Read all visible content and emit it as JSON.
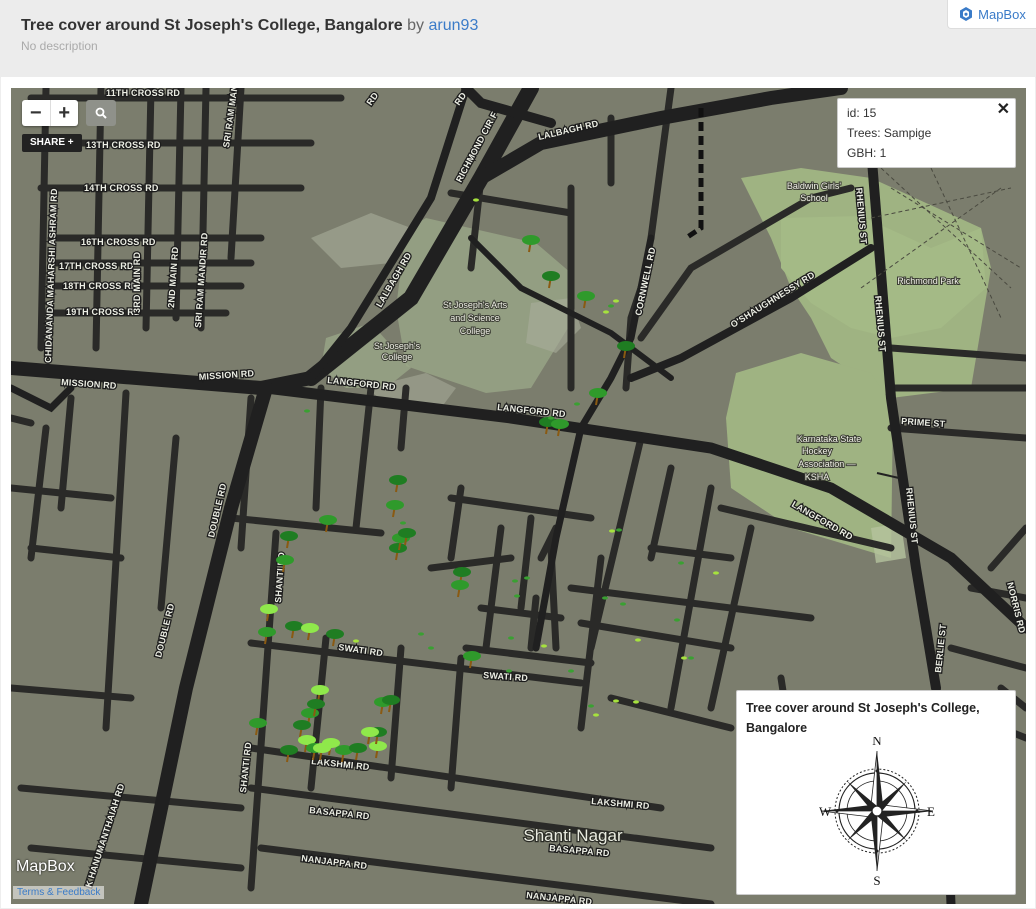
{
  "header": {
    "title": "Tree cover around St Joseph's College, Bangalore",
    "by": "by",
    "author": "arun93",
    "description": "No description",
    "brand": "MapBox"
  },
  "controls": {
    "zoom_out": "−",
    "zoom_in": "+",
    "share": "SHARE +"
  },
  "popup": {
    "id_line": "id: 15",
    "trees_line": "Trees: Sampige",
    "gbh_line": "GBH: 1",
    "close": "✕"
  },
  "legend": {
    "title": "Tree cover around St Joseph's College, Bangalore",
    "n": "N",
    "e": "E",
    "s": "S",
    "w": "W"
  },
  "map": {
    "watermark": "MapBox",
    "terms": "Terms & Feedback",
    "road_labels": {
      "r11th": "11TH CROSS RD",
      "r13th": "13TH CROSS RD",
      "r14th": "14TH CROSS RD",
      "r16th": "16TH CROSS RD",
      "r17th": "17TH CROSS RD",
      "r18th": "18TH CROSS RD",
      "r19th": "19TH CROSS RD",
      "chidananda": "CHIDANANDA MAHARSHI ASHRAM RD",
      "sriram1": "SRI RAM MANDIR RD",
      "sriram2": "SRI RAM MANDIR RD",
      "main3": "3RD MAIN RD",
      "main2": "2ND MAIN RD",
      "lalbagh": "LALBAGH RD",
      "lalbagh2": "LALBAGH RD",
      "richmond": "RICHMOND CIR F",
      "rd_top": "RD",
      "rd_top2": "RD",
      "mission": "MISSION RD",
      "mission2": "MISSION RD",
      "langford": "LANGFORD RD",
      "langford2": "LANGFORD RD",
      "langford3": "LANGFORD RD",
      "cornwell": "CORNWELL RD",
      "oshaughnessy": "O'SHAUGHNESSY RD",
      "rhenius": "RHENIUS ST",
      "rhenius2": "RHENIUS ST",
      "prime": "PRIME ST",
      "double": "DOUBLE RD",
      "double2": "DOUBLE RD",
      "swati": "SWATI RD",
      "swati2": "SWATI RD",
      "shanti": "SHANTI RD",
      "shanti2": "SHANTI RD",
      "lakshmi": "LAKSHMI RD",
      "lakshmi2": "LAKSHMI RD",
      "basappa": "BASAPPA RD",
      "basappa2": "BASAPPA RD",
      "nanjappa": "NANJAPPA RD",
      "nanjappa2": "NANJAPPA RD",
      "hanumanthaiah": "K HANUMANTHAIAH RD",
      "berlie": "BERLIE ST",
      "norris": "NORRIS RD"
    },
    "places": {
      "baldwin1": "Baldwin Girls'",
      "baldwin2": "School",
      "richmond_park": "Richmond Park",
      "arts1": "St Joseph's Arts",
      "arts2": "and Science",
      "arts3": "College",
      "sjc1": "St Joseph's",
      "sjc2": "College",
      "hockey1": "Karnataka State",
      "hockey2": "Hockey",
      "hockey3": "Association —",
      "hockey4": "KSHA",
      "shanti_nagar": "Shanti Nagar"
    }
  }
}
